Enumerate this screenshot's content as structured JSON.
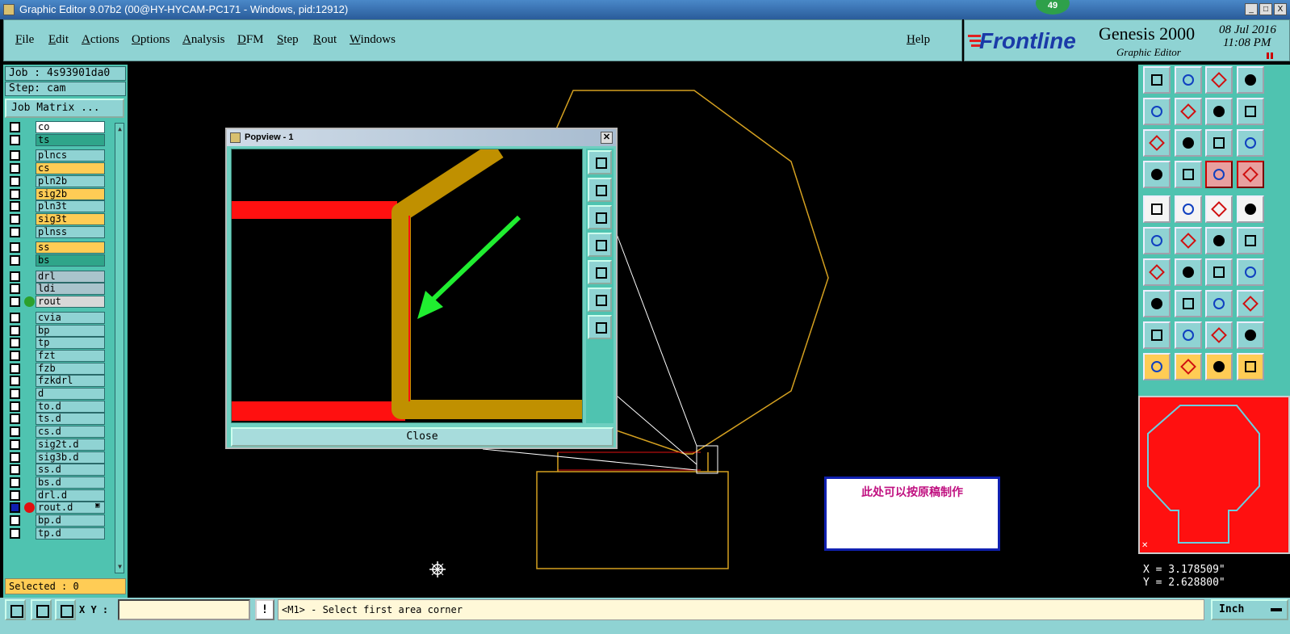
{
  "window": {
    "title": "Graphic Editor 9.07b2 (00@HY-HYCAM-PC171 - Windows, pid:12912)",
    "notification_count": "49",
    "buttons": [
      "_",
      "□",
      "X"
    ]
  },
  "menu": {
    "items": [
      "File",
      "Edit",
      "Actions",
      "Options",
      "Analysis",
      "DFM",
      "Step",
      "Rout",
      "Windows"
    ],
    "help": "Help"
  },
  "brand": {
    "logo": "Frontline",
    "product": "Genesis 2000",
    "subtitle": "Graphic Editor",
    "date": "08 Jul 2016",
    "time": "11:08 PM"
  },
  "job": {
    "job_label": "Job : 4s93901da0",
    "step_label": "Step: cam",
    "job_matrix_button": "Job Matrix ..."
  },
  "layers": [
    {
      "name": "co",
      "color": "#ffffff",
      "dot": ""
    },
    {
      "name": "ts",
      "color": "#2fa58a",
      "dot": ""
    },
    {
      "name": "plncs",
      "color": "#8fd3d3",
      "dot": ""
    },
    {
      "name": "cs",
      "color": "#ffcc55",
      "dot": ""
    },
    {
      "name": "pln2b",
      "color": "#8fd3d3",
      "dot": ""
    },
    {
      "name": "sig2b",
      "color": "#ffcc55",
      "dot": ""
    },
    {
      "name": "pln3t",
      "color": "#8fd3d3",
      "dot": ""
    },
    {
      "name": "sig3t",
      "color": "#ffcc55",
      "dot": ""
    },
    {
      "name": "plnss",
      "color": "#8fd3d3",
      "dot": ""
    },
    {
      "name": "ss",
      "color": "#ffcc55",
      "dot": ""
    },
    {
      "name": "bs",
      "color": "#2fa58a",
      "dot": ""
    },
    {
      "name": "drl",
      "color": "#a9c4cc",
      "dot": ""
    },
    {
      "name": "ldi",
      "color": "#a9c4cc",
      "dot": ""
    },
    {
      "name": "rout",
      "color": "#d8d8d8",
      "dot": "#2ca02c"
    },
    {
      "name": "cvia",
      "color": "#8fd3d3",
      "dot": ""
    },
    {
      "name": "bp",
      "color": "#8fd3d3",
      "dot": ""
    },
    {
      "name": "tp",
      "color": "#8fd3d3",
      "dot": ""
    },
    {
      "name": "fzt",
      "color": "#8fd3d3",
      "dot": ""
    },
    {
      "name": "fzb",
      "color": "#8fd3d3",
      "dot": ""
    },
    {
      "name": "fzkdrl",
      "color": "#8fd3d3",
      "dot": ""
    },
    {
      "name": "d",
      "color": "#8fd3d3",
      "dot": ""
    },
    {
      "name": "to.d",
      "color": "#8fd3d3",
      "dot": ""
    },
    {
      "name": "ts.d",
      "color": "#8fd3d3",
      "dot": ""
    },
    {
      "name": "cs.d",
      "color": "#8fd3d3",
      "dot": ""
    },
    {
      "name": "sig2t.d",
      "color": "#8fd3d3",
      "dot": ""
    },
    {
      "name": "sig3b.d",
      "color": "#8fd3d3",
      "dot": ""
    },
    {
      "name": "ss.d",
      "color": "#8fd3d3",
      "dot": ""
    },
    {
      "name": "bs.d",
      "color": "#8fd3d3",
      "dot": ""
    },
    {
      "name": "drl.d",
      "color": "#8fd3d3",
      "dot": ""
    },
    {
      "name": "rout.d",
      "color": "#8fd3d3",
      "dot": "#e01010",
      "mark": "▣",
      "selected": true
    },
    {
      "name": "bp.d",
      "color": "#8fd3d3",
      "dot": ""
    },
    {
      "name": "tp.d",
      "color": "#8fd3d3",
      "dot": ""
    }
  ],
  "selected_label": "Selected : 0",
  "popview": {
    "title": "Popview - 1",
    "close_button": "Close"
  },
  "note_text": "此处可以按原稿制作",
  "coords": {
    "x": "X = 3.178509\"",
    "y": "Y = 2.628800\""
  },
  "bottom": {
    "xy_label": "X Y :",
    "xy_value": "",
    "warn": "!",
    "prompt": "<M1> - Select first area corner",
    "units": "Inch"
  },
  "colors": {
    "panel": "#8fd3d3",
    "panel_dark": "#4fc3b0",
    "outline": "#d4a020",
    "signal": "#ff1010",
    "trace": "#c09000",
    "arrow": "#20ee30",
    "note_border": "#1020b0",
    "note_text": "#c01080"
  }
}
